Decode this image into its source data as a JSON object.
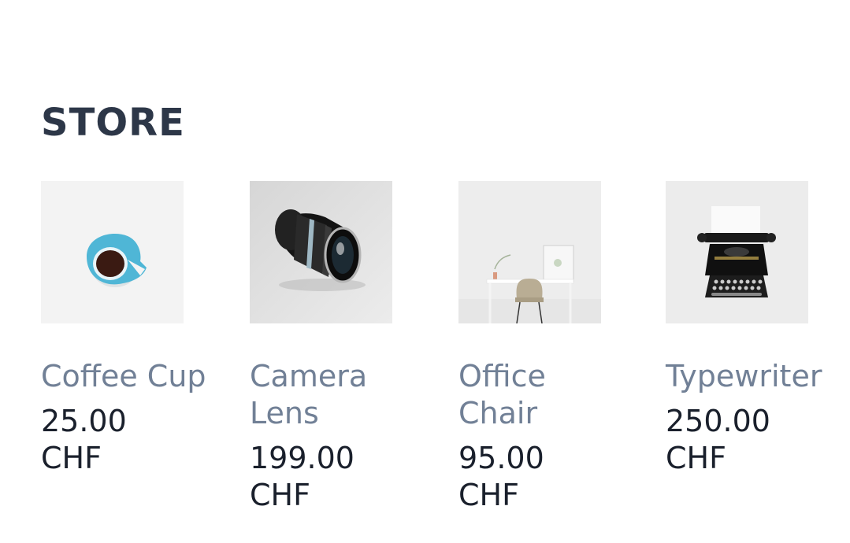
{
  "store": {
    "title": "STORE",
    "products": [
      {
        "name": "Coffee Cup",
        "price": "25.00 CHF",
        "image_icon": "coffee-cup-photo"
      },
      {
        "name": "Camera Lens",
        "price": "199.00 CHF",
        "image_icon": "camera-lens-photo"
      },
      {
        "name": "Office Chair",
        "price": "95.00 CHF",
        "image_icon": "office-chair-photo"
      },
      {
        "name": "Typewriter",
        "price": "250.00 CHF",
        "image_icon": "typewriter-photo"
      }
    ]
  },
  "colors": {
    "title": "#2d3748",
    "product_name": "#718096",
    "price": "#1a202c",
    "cup_accent": "#4fb6d6"
  }
}
